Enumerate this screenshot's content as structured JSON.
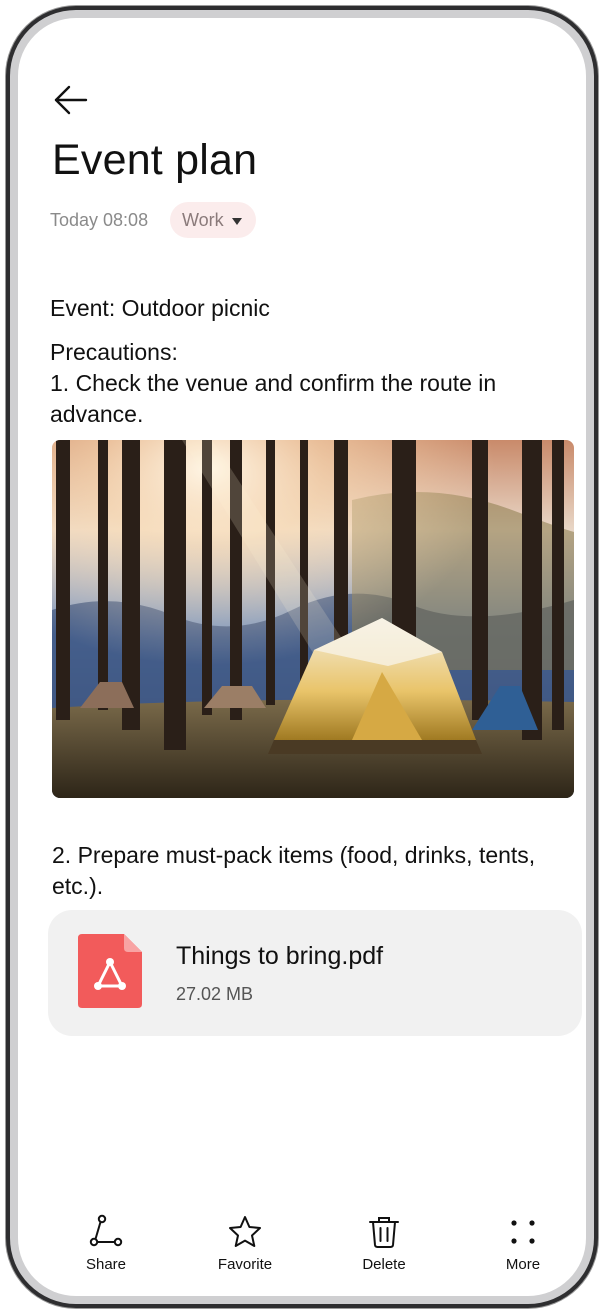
{
  "header": {
    "back_icon": "arrow-left-icon",
    "title": "Event plan",
    "time": "Today 08:08",
    "category": "Work"
  },
  "note": {
    "event_line": "Event: Outdoor picnic",
    "precautions_heading": "Precautions:",
    "step1": "1. Check the venue and confirm the route in advance.",
    "image_alt": "Camping tents among trees in a sunlit forest",
    "step2": "2. Prepare must-pack items (food, drinks, tents, etc.)."
  },
  "attachment": {
    "icon": "pdf-file-icon",
    "name": "Things to bring.pdf",
    "size": "27.02 MB",
    "accent": "#f25b5b"
  },
  "toolbar": {
    "share": "Share",
    "favorite": "Favorite",
    "delete": "Delete",
    "more": "More"
  }
}
